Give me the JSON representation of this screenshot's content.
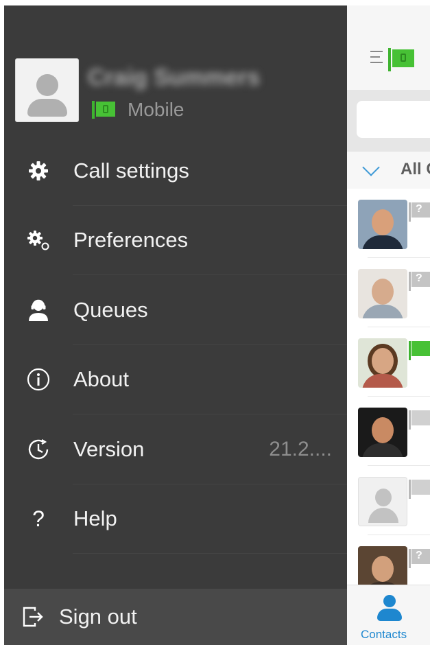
{
  "profile": {
    "name": "Craig Summers",
    "status": "Mobile",
    "status_color": "#47c135"
  },
  "menu": {
    "items": [
      {
        "label": "Call settings",
        "icon": "gear-icon"
      },
      {
        "label": "Preferences",
        "icon": "gears-icon"
      },
      {
        "label": "Queues",
        "icon": "headset-user-icon"
      },
      {
        "label": "About",
        "icon": "info-icon"
      },
      {
        "label": "Version",
        "icon": "clock-icon",
        "value": "21.2...."
      },
      {
        "label": "Help",
        "icon": "question-icon"
      }
    ],
    "sign_out": {
      "label": "Sign out",
      "icon": "sign-out-icon"
    }
  },
  "strip": {
    "filter_label": "All C",
    "tab_label": "Contacts",
    "accent": "#1e87cf",
    "contacts": [
      {
        "presence": "unknown"
      },
      {
        "presence": "unknown"
      },
      {
        "presence": "available"
      },
      {
        "presence": "offline"
      },
      {
        "presence": "offline"
      },
      {
        "presence": "unknown"
      }
    ]
  }
}
